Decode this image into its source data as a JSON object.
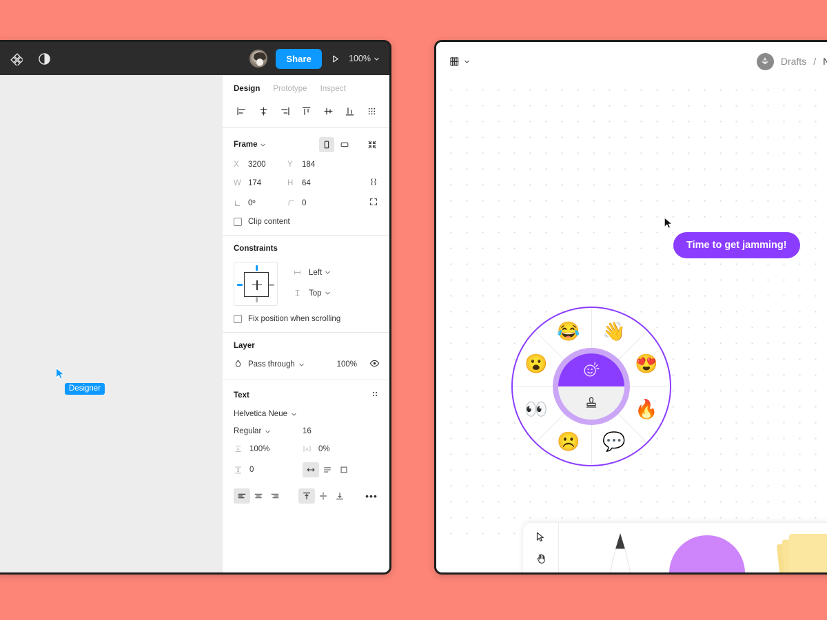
{
  "background_color": "#FC8577",
  "figma_window": {
    "topbar": {
      "menu_icon": "figma-logo-icon",
      "contrast_icon": "contrast-icon",
      "avatar_icon": "user-avatar",
      "share_label": "Share",
      "present_icon": "play-icon",
      "zoom_label": "100%",
      "zoom_caret": "chevron-down-icon"
    },
    "canvas": {
      "cursor_label": "Designer",
      "cursor_color": "#0D99FF"
    },
    "panel": {
      "tabs": [
        {
          "label": "Design",
          "active": true
        },
        {
          "label": "Prototype",
          "active": false
        },
        {
          "label": "Inspect",
          "active": false
        }
      ],
      "align_tools": [
        "align-left-icon",
        "align-horizontal-center-icon",
        "align-right-icon",
        "align-top-icon",
        "align-vertical-center-icon",
        "align-bottom-icon",
        "tidy-up-icon"
      ],
      "frame": {
        "title": "Frame",
        "orientation_portrait": "portrait-icon",
        "orientation_landscape": "landscape-icon",
        "resize_icon": "resize-to-fit-icon",
        "x_label": "X",
        "x_value": "3200",
        "y_label": "Y",
        "y_value": "184",
        "w_label": "W",
        "w_value": "174",
        "h_label": "H",
        "h_value": "64",
        "ratio_icon": "link-ratio-icon",
        "rotation_label": "rotation-icon",
        "rotation_value": "0º",
        "corner_label": "corner-radius-icon",
        "corner_value": "0",
        "independent_corners_icon": "independent-corners-icon",
        "clip_content_label": "Clip content"
      },
      "constraints": {
        "title": "Constraints",
        "horizontal_value": "Left",
        "vertical_value": "Top",
        "fix_position_label": "Fix position when scrolling"
      },
      "layer": {
        "title": "Layer",
        "blend_icon": "blend-mode-icon",
        "blend_mode": "Pass through",
        "opacity": "100%",
        "visibility_icon": "eye-icon"
      },
      "text": {
        "title": "Text",
        "settings_icon": "text-settings-icon",
        "font_family": "Helvetica Neue",
        "font_weight": "Regular",
        "font_size": "16",
        "line_height_icon": "line-height-icon",
        "line_height": "100%",
        "letter_spacing_icon": "letter-spacing-icon",
        "letter_spacing": "0%",
        "paragraph_spacing_icon": "paragraph-spacing-icon",
        "paragraph_spacing": "0",
        "resize_modes": [
          "auto-width-icon",
          "auto-height-icon",
          "fixed-size-icon"
        ],
        "resize_selected": 0,
        "h_align": [
          "align-text-left-icon",
          "align-text-center-icon",
          "align-text-right-icon"
        ],
        "h_align_selected": 0,
        "v_align": [
          "align-text-top-icon",
          "align-text-middle-icon",
          "align-text-bottom-icon"
        ],
        "v_align_selected": 0,
        "more_label": "•••"
      }
    }
  },
  "figjam_window": {
    "topbar": {
      "logo_icon": "figjam-logo-icon",
      "logo_caret": "chevron-down-icon",
      "avatar_icon": "team-avatar",
      "breadcrumb_root": "Drafts",
      "breadcrumb_sep": "/",
      "breadcrumb_current": "Ne"
    },
    "canvas": {
      "callout_text": "Time to get jamming!",
      "callout_color": "#8B3DFF",
      "cursor_icon": "pointer-cursor-icon"
    },
    "emoji_wheel": {
      "ring_color": "#8B3DFF",
      "center_top_icon": "reaction-smiley-icon",
      "center_top_color": "#8B3DFF",
      "center_bottom_icon": "stamp-icon",
      "emojis": [
        {
          "name": "joy-emoji",
          "glyph": "😂",
          "angle": -112.5
        },
        {
          "name": "wave-emoji",
          "glyph": "👋",
          "angle": -67.5
        },
        {
          "name": "heart-eyes-emoji",
          "glyph": "😍",
          "angle": -22.5
        },
        {
          "name": "fire-emoji",
          "glyph": "🔥",
          "angle": 22.5
        },
        {
          "name": "speech-balloon-emoji",
          "glyph": "💬",
          "angle": 67.5
        },
        {
          "name": "frowning-emoji",
          "glyph": "☹️",
          "angle": 112.5
        },
        {
          "name": "eyes-emoji",
          "glyph": "👀",
          "angle": 157.5
        },
        {
          "name": "astonished-emoji",
          "glyph": "😮",
          "angle": -157.5
        }
      ]
    },
    "toolbar": {
      "pointer_icon": "cursor-arrow-icon",
      "hand_icon": "hand-tool-icon",
      "pen_icon": "marker-pen-tool",
      "shape_icon": "shape-tool",
      "shape_color": "#CE84FA",
      "sticky_icon": "sticky-note-tool",
      "sticky_color": "#FBE79F"
    }
  }
}
